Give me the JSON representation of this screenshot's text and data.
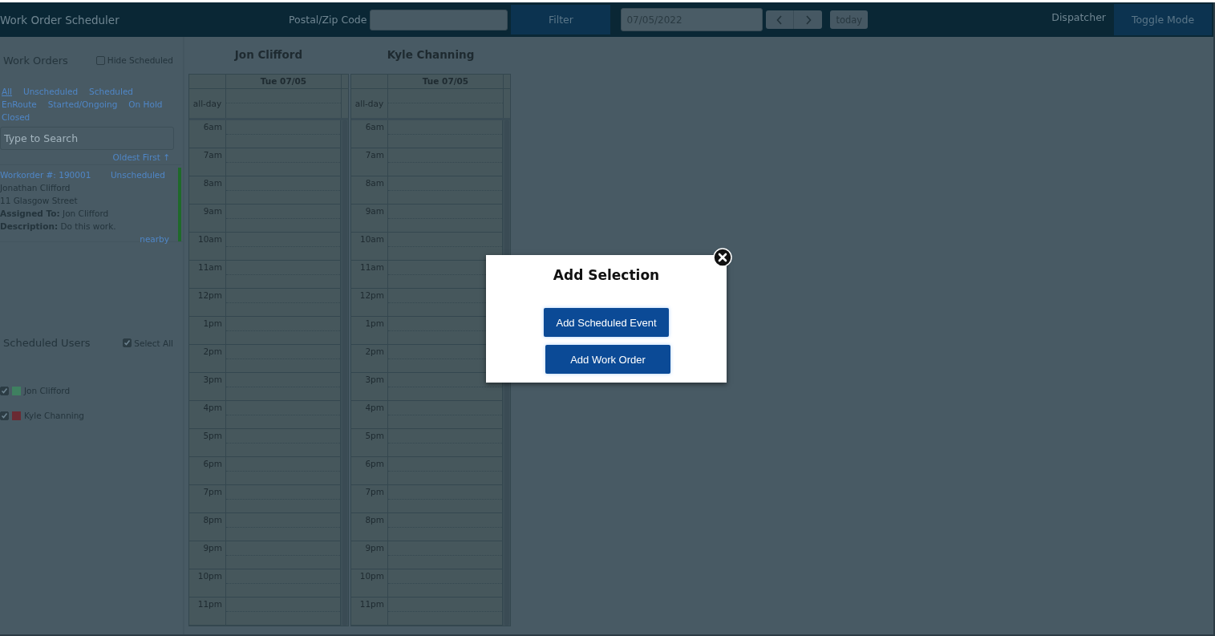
{
  "header": {
    "title": "Work Order Scheduler",
    "postal_label": "Postal/Zip Code",
    "filter_button": "Filter",
    "date_value": "07/05/2022",
    "today_button": "today",
    "role": "Dispatcher",
    "toggle_button": "Toggle Mode"
  },
  "sidebar": {
    "work_orders_heading": "Work Orders",
    "hide_scheduled": {
      "label": "Hide Scheduled",
      "checked": false
    },
    "filters": [
      {
        "label": "All",
        "selected": true
      },
      {
        "label": "Unscheduled",
        "selected": false
      },
      {
        "label": "Scheduled",
        "selected": false
      },
      {
        "label": "EnRoute",
        "selected": false
      },
      {
        "label": "Started/Ongoing",
        "selected": false
      },
      {
        "label": "On Hold",
        "selected": false
      },
      {
        "label": "Closed",
        "selected": false
      }
    ],
    "search": {
      "placeholder": "Type to Search"
    },
    "sort": "Oldest First ↑",
    "work_orders": [
      {
        "number": "Workorder #: 190001",
        "status": "Unscheduled",
        "customer": "Jonathan Clifford",
        "address": "11 Glasgow Street",
        "assigned": "**Assigned To:** Jon Clifford",
        "description": "**Description:** Do this work.",
        "link": "nearby",
        "color": "#1f6a2a"
      }
    ],
    "users_heading": "Scheduled Users",
    "select_all": {
      "label": "Select All",
      "checked": true
    },
    "users": [
      {
        "name": "Jon Clifford",
        "checked": true,
        "color": "#3f8060"
      },
      {
        "name": "Kyle Channing",
        "checked": true,
        "color": "#6a2a33"
      }
    ]
  },
  "calendars": [
    {
      "name": "Jon Clifford",
      "date_header": "Tue 07/05",
      "allday_label": "all-day",
      "hours": [
        "6am",
        "7am",
        "8am",
        "9am",
        "10am",
        "11am",
        "12pm",
        "1pm",
        "2pm",
        "3pm",
        "4pm",
        "5pm",
        "6pm",
        "7pm",
        "8pm",
        "9pm",
        "10pm",
        "11pm"
      ]
    },
    {
      "name": "Kyle Channing",
      "date_header": "Tue 07/05",
      "allday_label": "all-day",
      "hours": [
        "6am",
        "7am",
        "8am",
        "9am",
        "10am",
        "11am",
        "12pm",
        "1pm",
        "2pm",
        "3pm",
        "4pm",
        "5pm",
        "6pm",
        "7pm",
        "8pm",
        "9pm",
        "10pm",
        "11pm"
      ]
    }
  ],
  "modal": {
    "title": "Add Selection",
    "buttons": [
      "Add Scheduled Event",
      "Add Work Order"
    ]
  }
}
